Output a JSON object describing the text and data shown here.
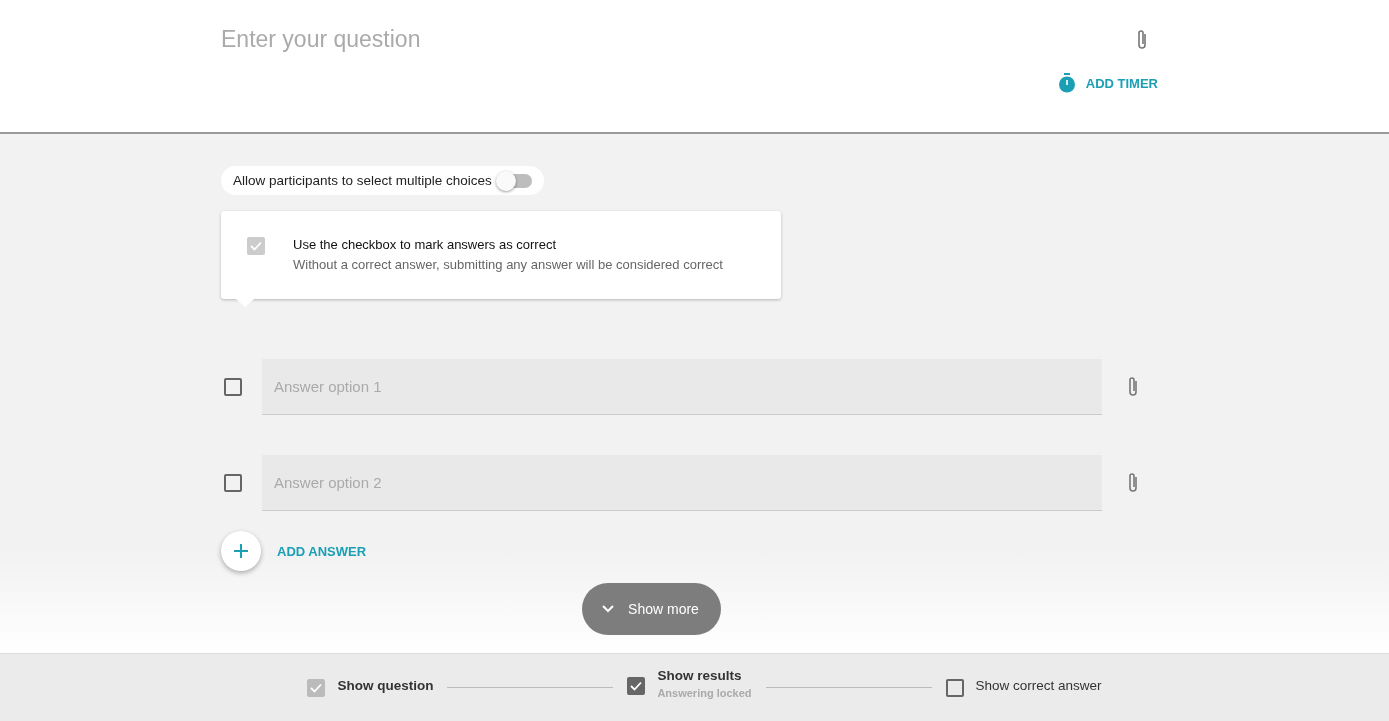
{
  "question": {
    "placeholder": "Enter your question"
  },
  "add_timer": "ADD TIMER",
  "multiple_choice": {
    "label": "Allow participants to select multiple choices",
    "on": false
  },
  "hint": {
    "checked": true,
    "title": "Use the checkbox to mark answers as correct",
    "text": "Without a correct answer, submitting any answer will be considered correct"
  },
  "answers": [
    {
      "placeholder": "Answer option 1",
      "checked": false
    },
    {
      "placeholder": "Answer option 2",
      "checked": false
    }
  ],
  "add_answer": "ADD ANSWER",
  "show_more": "Show more",
  "steps": [
    {
      "label": "Show question",
      "checked": true,
      "disabled": true
    },
    {
      "label": "Show results",
      "sublabel": "Answering locked",
      "checked": true,
      "disabled": false
    },
    {
      "label": "Show correct answer",
      "checked": false,
      "disabled": false
    }
  ]
}
